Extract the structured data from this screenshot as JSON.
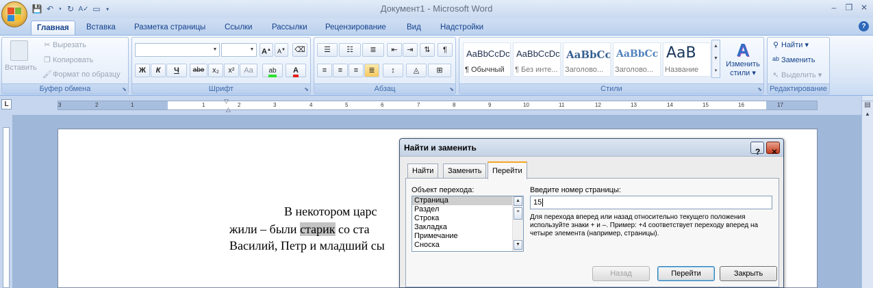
{
  "window": {
    "title": "Документ1 - Microsoft Word"
  },
  "tabs": [
    "Главная",
    "Вставка",
    "Разметка страницы",
    "Ссылки",
    "Рассылки",
    "Рецензирование",
    "Вид",
    "Надстройки"
  ],
  "clipboard": {
    "label": "Буфер обмена",
    "paste": "Вставить",
    "cut": "Вырезать",
    "copy": "Копировать",
    "format_painter": "Формат по образцу"
  },
  "font": {
    "label": "Шрифт",
    "name": "",
    "size": "",
    "bold": "Ж",
    "italic": "К",
    "underline": "Ч",
    "strike": "abe",
    "subscript": "x₂",
    "superscript": "x²",
    "case": "Aa",
    "grow": "A",
    "shrink": "A"
  },
  "paragraph": {
    "label": "Абзац"
  },
  "styles": {
    "label": "Стили",
    "items": [
      {
        "sample": "AaBbCcDc",
        "name": "¶ Обычный"
      },
      {
        "sample": "AaBbCcDc",
        "name": "¶ Без инте..."
      },
      {
        "sample": "AaBbCc",
        "name": "Заголово..."
      },
      {
        "sample": "AaBbCc",
        "name": "Заголово..."
      },
      {
        "sample": "AaB",
        "name": "Название"
      }
    ],
    "change_styles_1": "Изменить",
    "change_styles_2": "стили"
  },
  "editing": {
    "label": "Редактирование",
    "find": "Найти",
    "replace": "Заменить",
    "select": "Выделить"
  },
  "ruler": {
    "left_numbers": [
      "3",
      "2",
      "1"
    ],
    "numbers": [
      "1",
      "2",
      "3",
      "4",
      "5",
      "6",
      "7",
      "8",
      "9",
      "10",
      "11",
      "12",
      "13",
      "14",
      "15",
      "16",
      "17"
    ]
  },
  "document": {
    "line1": "В   некотором   царс",
    "line2_a": "жили  –  были  ",
    "line2_hl": "старик",
    "line2_b": " со  ста",
    "line3": "Василий, Петр и младший сы"
  },
  "dialog": {
    "title": "Найти и заменить",
    "tabs": [
      "Найти",
      "Заменить",
      "Перейти"
    ],
    "goto_what_label": "Объект перехода:",
    "goto_items": [
      "Страница",
      "Раздел",
      "Строка",
      "Закладка",
      "Примечание",
      "Сноска"
    ],
    "page_number_label": "Введите номер страницы:",
    "page_number_value": "15",
    "note": "Для перехода вперед или назад относительно текущего положения используйте знаки + и –. Пример: +4 соответствует переходу вперед на четыре элемента (например, страницы).",
    "buttons": {
      "back": "Назад",
      "goto": "Перейти",
      "close": "Закрыть"
    }
  }
}
